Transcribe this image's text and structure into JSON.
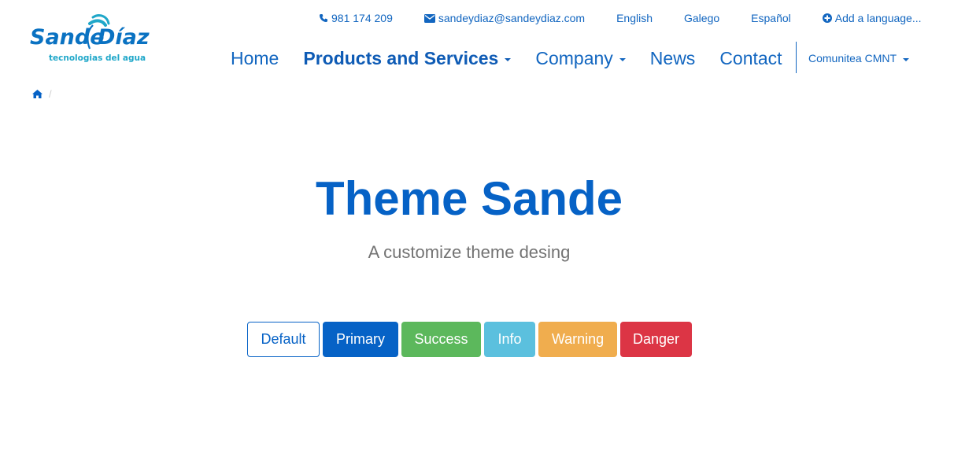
{
  "brand": {
    "name_part1": "Sande",
    "name_part2": "Díaz",
    "tagline": "tecnologias del agua"
  },
  "topbar": {
    "phone": "981 174 209",
    "email": "sandeydiaz@sandeydiaz.com",
    "languages": [
      "English",
      "Galego",
      "Español"
    ],
    "add_language": "Add a language..."
  },
  "nav": {
    "items": [
      {
        "label": "Home"
      },
      {
        "label": "Products and Services"
      },
      {
        "label": "Company"
      },
      {
        "label": "News"
      },
      {
        "label": "Contact"
      }
    ],
    "community": "Comunitea CMNT"
  },
  "breadcrumb": {
    "separator": "/"
  },
  "hero": {
    "title": "Theme Sande",
    "subtitle": "A customize theme desing"
  },
  "buttons": [
    "Default",
    "Primary",
    "Success",
    "Info",
    "Warning",
    "Danger"
  ],
  "colors": {
    "brand_blue": "#0662c6",
    "success": "#5cb85c",
    "info": "#5bc0de",
    "warning": "#f0ad4e",
    "danger": "#dc3545",
    "subtitle_gray": "#737373"
  }
}
